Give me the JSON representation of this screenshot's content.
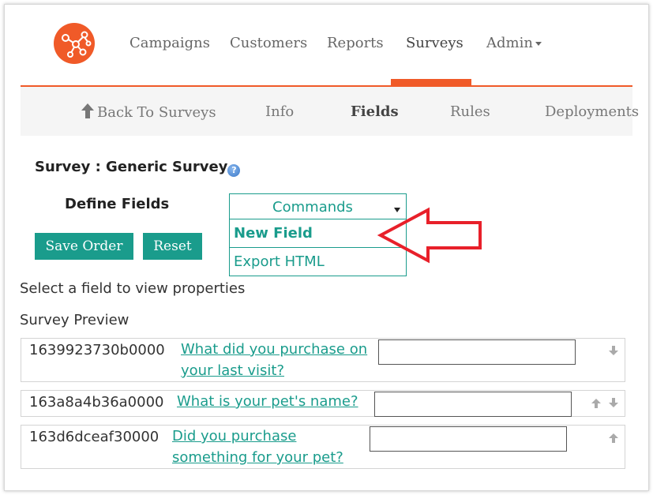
{
  "top_nav": {
    "logo_icon": "network-nodes-icon",
    "items": [
      {
        "label": "Campaigns"
      },
      {
        "label": "Customers"
      },
      {
        "label": "Reports"
      },
      {
        "label": "Surveys",
        "active": true
      },
      {
        "label": "Admin",
        "has_dropdown": true
      }
    ]
  },
  "sub_nav": {
    "back_label": "Back To Surveys",
    "info_label": "Info",
    "fields_label": "Fields",
    "rules_label": "Rules",
    "deployments_label": "Deployments"
  },
  "survey": {
    "title": "Survey : Generic Survey",
    "help_icon": "?"
  },
  "define_fields": {
    "label": "Define Fields",
    "commands": {
      "label": "Commands",
      "items": [
        "New Field",
        "Export HTML"
      ]
    },
    "save_order_label": "Save Order",
    "reset_label": "Reset"
  },
  "hint_text": "Select a field to view properties",
  "preview": {
    "label": "Survey Preview",
    "rows": [
      {
        "id": "1639923730b0000",
        "question": "What did you purchase on your last visit?",
        "answer": ""
      },
      {
        "id": "163a8a4b36a0000",
        "question": "What is your pet's name?",
        "answer": ""
      },
      {
        "id": "163d6dceaf30000",
        "question": "Did you purchase something for your pet?",
        "answer": ""
      }
    ]
  },
  "colors": {
    "brand_orange": "#f05a28",
    "teal": "#1a9c8c",
    "annotation_red": "#e8202a"
  }
}
